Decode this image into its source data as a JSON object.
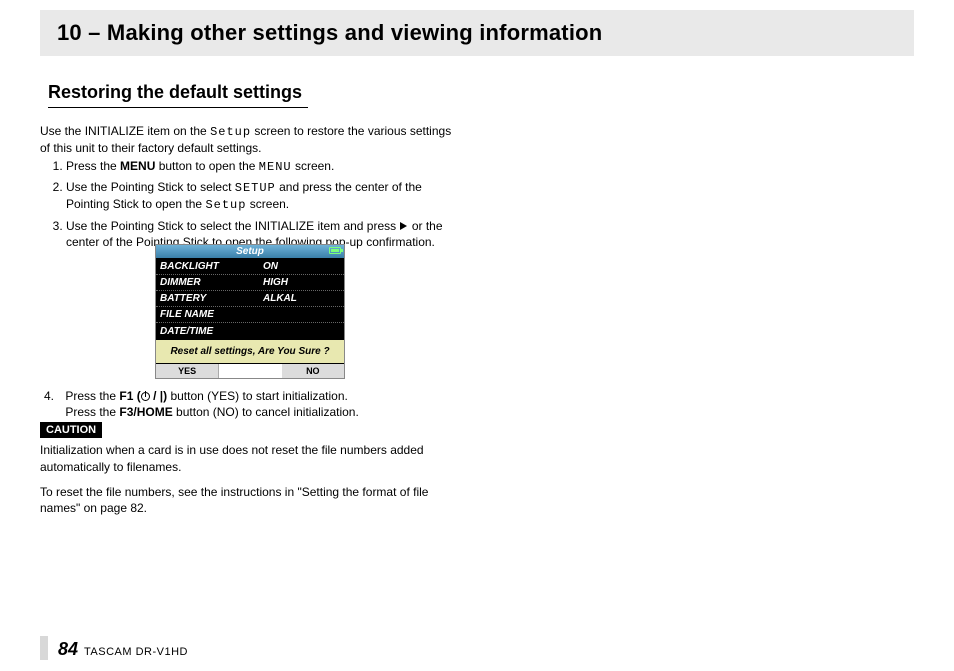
{
  "chapter": "10 – Making other settings and viewing information",
  "section": "Restoring the default settings",
  "intro_a": "Use the INITIALIZE item on the ",
  "intro_screen": "Setup",
  "intro_b": " screen to restore the various settings of this unit to their factory default settings.",
  "steps": {
    "s1a": "Press the ",
    "s1b": "MENU",
    "s1c": " button to open the ",
    "s1d": "MENU",
    "s1e": " screen.",
    "s2a": "Use the Pointing Stick to select ",
    "s2b": "SETUP",
    "s2c": " and press the center of the Pointing Stick to open the ",
    "s2d": "Setup",
    "s2e": " screen.",
    "s3a": "Use the Pointing Stick to select the INITIALIZE item and press ",
    "s3b": " or the center of the Pointing Stick to open the following pop-up confirmation.",
    "s4a": "Press the ",
    "s4b": "F1 (",
    "s4c": ")",
    "s4d": " button (YES) to start initialization.",
    "s4e": "Press the ",
    "s4f": "F3/HOME",
    "s4g": " button (NO) to cancel initialization."
  },
  "lcd_screen": {
    "title": "Setup",
    "rows": [
      {
        "k": "BACKLIGHT",
        "v": "ON"
      },
      {
        "k": "DIMMER",
        "v": "HIGH"
      },
      {
        "k": "BATTERY",
        "v": "ALKAL"
      },
      {
        "k": "FILE NAME",
        "v": ""
      },
      {
        "k": "DATE/TIME",
        "v": ""
      }
    ],
    "prompt": "Reset all settings, Are You Sure ?",
    "yes": "YES",
    "no": "NO"
  },
  "caution_label": "CAUTION",
  "caution_p1": "Initialization when a card is in use does not reset the file numbers added automatically to filenames.",
  "caution_p2": "To reset the file numbers, see the instructions in \"Setting the format of file names\" on page 82.",
  "footer": {
    "page": "84",
    "model": "TASCAM  DR-V1HD"
  }
}
